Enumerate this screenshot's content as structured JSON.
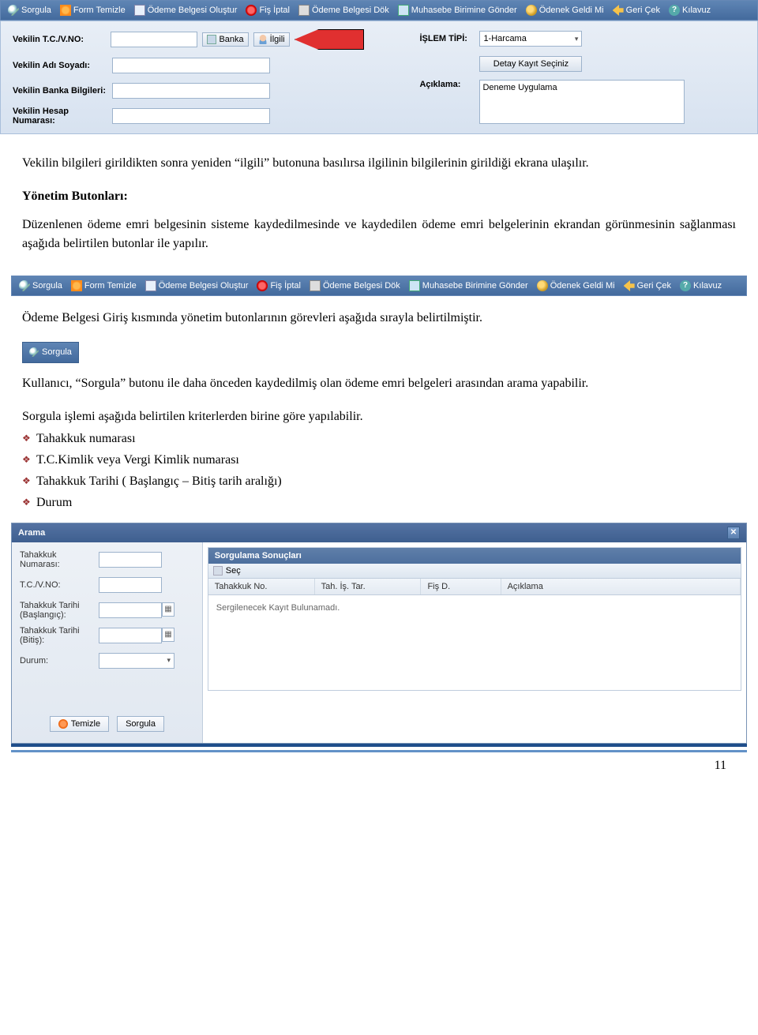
{
  "toolbar": {
    "items": [
      {
        "label": "Sorgula",
        "name": "sorgula-button",
        "icon": "search"
      },
      {
        "label": "Form Temizle",
        "name": "form-temizle-button",
        "icon": "clear"
      },
      {
        "label": "Ödeme Belgesi Oluştur",
        "name": "odeme-olustur-button",
        "icon": "doc"
      },
      {
        "label": "Fiş İptal",
        "name": "fis-iptal-button",
        "icon": "cancel"
      },
      {
        "label": "Ödeme Belgesi Dök",
        "name": "odeme-dok-button",
        "icon": "print"
      },
      {
        "label": "Muhasebe Birimine Gönder",
        "name": "muhasebe-gonder-button",
        "icon": "send"
      },
      {
        "label": "Ödenek Geldi Mi",
        "name": "odenek-geldi-button",
        "icon": "badge"
      },
      {
        "label": "Geri Çek",
        "name": "geri-cek-button",
        "icon": "back"
      },
      {
        "label": "Kılavuz",
        "name": "kilavuz-button",
        "icon": "help"
      }
    ]
  },
  "form": {
    "left": {
      "tc_label": "Vekilin T.C./V.NO:",
      "tc_value": "",
      "banka_btn": "Banka",
      "ilgili_btn": "İlgili",
      "ad_label": "Vekilin Adı Soyadı:",
      "ad_value": "",
      "banka_label": "Vekilin Banka Bilgileri:",
      "banka_value": "",
      "hesap_label": "Vekilin Hesap Numarası:",
      "hesap_value": ""
    },
    "right": {
      "islem_label": "İŞLEM TİPİ:",
      "islem_value": "1-Harcama",
      "detay_btn": "Detay Kayıt Seçiniz",
      "aciklama_label": "Açıklama:",
      "aciklama_value": "Deneme Uygulama"
    }
  },
  "body": {
    "p1": "Vekilin bilgileri girildikten sonra yeniden “ilgili” butonuna basılırsa ilgilinin bilgilerinin girildiği ekrana ulaşılır.",
    "h1": "Yönetim Butonları:",
    "p2": "Düzenlenen ödeme emri belgesinin sisteme kaydedilmesinde ve kaydedilen ödeme emri belgelerinin ekrandan görünmesinin sağlanması aşağıda belirtilen butonlar ile yapılır.",
    "p3": "Ödeme Belgesi Giriş kısmında yönetim butonlarının görevleri aşağıda sırayla belirtilmiştir.",
    "p4": "Kullanıcı, “Sorgula” butonu ile daha önceden kaydedilmiş olan ödeme emri belgeleri arasından arama yapabilir.",
    "p5": "Sorgula işlemi aşağıda belirtilen kriterlerden birine göre yapılabilir.",
    "bullets": [
      "Tahakkuk numarası",
      "T.C.Kimlik veya Vergi Kimlik numarası",
      "Tahakkuk Tarihi ( Başlangıç – Bitiş tarih aralığı)",
      "Durum"
    ],
    "chip": "Sorgula"
  },
  "arama": {
    "title": "Arama",
    "left": {
      "tahno_label": "Tahakkuk Numarası:",
      "tc_label": "T.C./V.NO:",
      "bas_label": "Tahakkuk Tarihi (Başlangıç):",
      "bit_label": "Tahakkuk Tarihi (Bitiş):",
      "durum_label": "Durum:",
      "durum_value": "",
      "temizle": "Temizle",
      "sorgula": "Sorgula"
    },
    "right": {
      "header": "Sorgulama Sonuçları",
      "sec": "Seç",
      "cols": {
        "c1": "Tahakkuk No.",
        "c2": "Tah. İş. Tar.",
        "c3": "Fiş D.",
        "c4": "Açıklama"
      },
      "empty": "Sergilenecek Kayıt Bulunamadı."
    }
  },
  "page_number": "11"
}
